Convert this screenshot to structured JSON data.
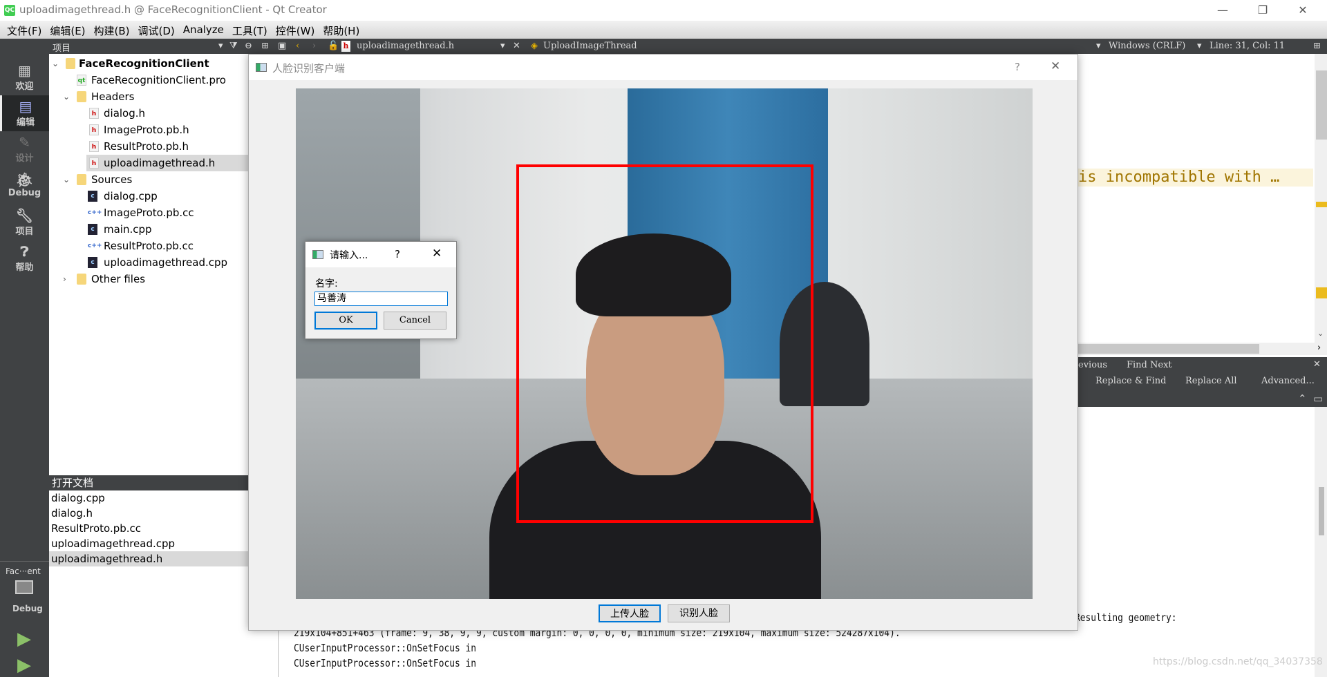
{
  "window": {
    "title": "uploadimagethread.h @ FaceRecognitionClient - Qt Creator",
    "logo": "QC"
  },
  "menu": [
    "文件(F)",
    "编辑(E)",
    "构建(B)",
    "调试(D)",
    "Analyze",
    "工具(T)",
    "控件(W)",
    "帮助(H)"
  ],
  "toolbar": {
    "panel_title": "项目",
    "file": "uploadimagethread.h",
    "symbol": "UploadImageThread",
    "line_ending": "Windows (CRLF)",
    "position": "Line: 31, Col: 11"
  },
  "modes": [
    {
      "label": "欢迎",
      "icon": "grid-icon"
    },
    {
      "label": "编辑",
      "icon": "edit-icon"
    },
    {
      "label": "设计",
      "icon": "pencil-icon"
    },
    {
      "label": "Debug",
      "icon": "bug-icon"
    },
    {
      "label": "项目",
      "icon": "wrench-icon"
    },
    {
      "label": "帮助",
      "icon": "help-icon"
    }
  ],
  "kit": {
    "project": "Fac···ent",
    "build": "Debug"
  },
  "tree": {
    "root": "FaceRecognitionClient",
    "pro": "FaceRecognitionClient.pro",
    "headers_label": "Headers",
    "headers": [
      "dialog.h",
      "ImageProto.pb.h",
      "ResultProto.pb.h",
      "uploadimagethread.h"
    ],
    "sources_label": "Sources",
    "sources": [
      "dialog.cpp",
      "ImageProto.pb.cc",
      "main.cpp",
      "ResultProto.pb.cc",
      "uploadimagethread.cpp"
    ],
    "other_label": "Other files",
    "selected": "uploadimagethread.h"
  },
  "open_docs": {
    "title": "打开文档",
    "items": [
      "dialog.cpp",
      "dialog.h",
      "ResultProto.pb.cc",
      "uploadimagethread.cpp",
      "uploadimagethread.h"
    ],
    "selected": "uploadimagethread.h"
  },
  "editor": {
    "warning": "is incompatible with …",
    "warning_color": "#a07500"
  },
  "find": {
    "prev": "evious",
    "next": "Find Next",
    "replace_find": "Replace & Find",
    "replace_all": "Replace All",
    "advanced": "Advanced..."
  },
  "output": {
    "lines": [
      "Resulting geometry:",
      "219x104+851+463 (frame: 9, 38, 9, 9, custom margin: 0, 0, 0, 0, minimum size: 219x104, maximum size: 524287x104).",
      "CUserInputProcessor::OnSetFocus in",
      "CUserInputProcessor::OnSetFocus in"
    ]
  },
  "watermark": "https://blog.csdn.net/qq_34037358",
  "main_dialog": {
    "title": "人脸识别客户端",
    "help": "?",
    "upload_button": "上传人脸",
    "recognize_button": "识别人脸",
    "face_box_color": "#ff0000"
  },
  "input_dialog": {
    "title": "请输入...",
    "help": "?",
    "label": "名字:",
    "value": "马善涛",
    "ok": "OK",
    "cancel": "Cancel"
  }
}
